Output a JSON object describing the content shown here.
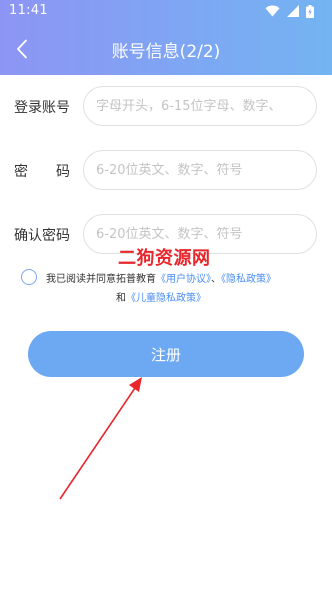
{
  "status_bar": {
    "time": "11:41"
  },
  "nav": {
    "title": "账号信息(2/2)",
    "back_icon": "chevron-left-icon"
  },
  "form": {
    "fields": [
      {
        "label": "登录账号",
        "placeholder": "字母开头，6-15位字母、数字、",
        "value": ""
      },
      {
        "label": "密　　码",
        "placeholder": "6-20位英文、数字、符号",
        "value": ""
      },
      {
        "label": "确认密码",
        "placeholder": "6-20位英文、数字、符号",
        "value": ""
      }
    ]
  },
  "agreement": {
    "prefix": "我已阅读并同意拓普教育",
    "user_agreement": "《用户协议》",
    "separator": "、",
    "privacy_policy": "《隐私政策》",
    "and": "和",
    "child_privacy_policy": "《儿童隐私政策》",
    "checked": false
  },
  "register_label": "注册",
  "watermark": "二狗资源网",
  "colors": {
    "header_start": "#8d95f4",
    "header_end": "#74b4f2",
    "button": "#6da8f3",
    "link": "#4a8ef5",
    "watermark": "#e8262b",
    "annotation_arrow": "#e8262b"
  }
}
